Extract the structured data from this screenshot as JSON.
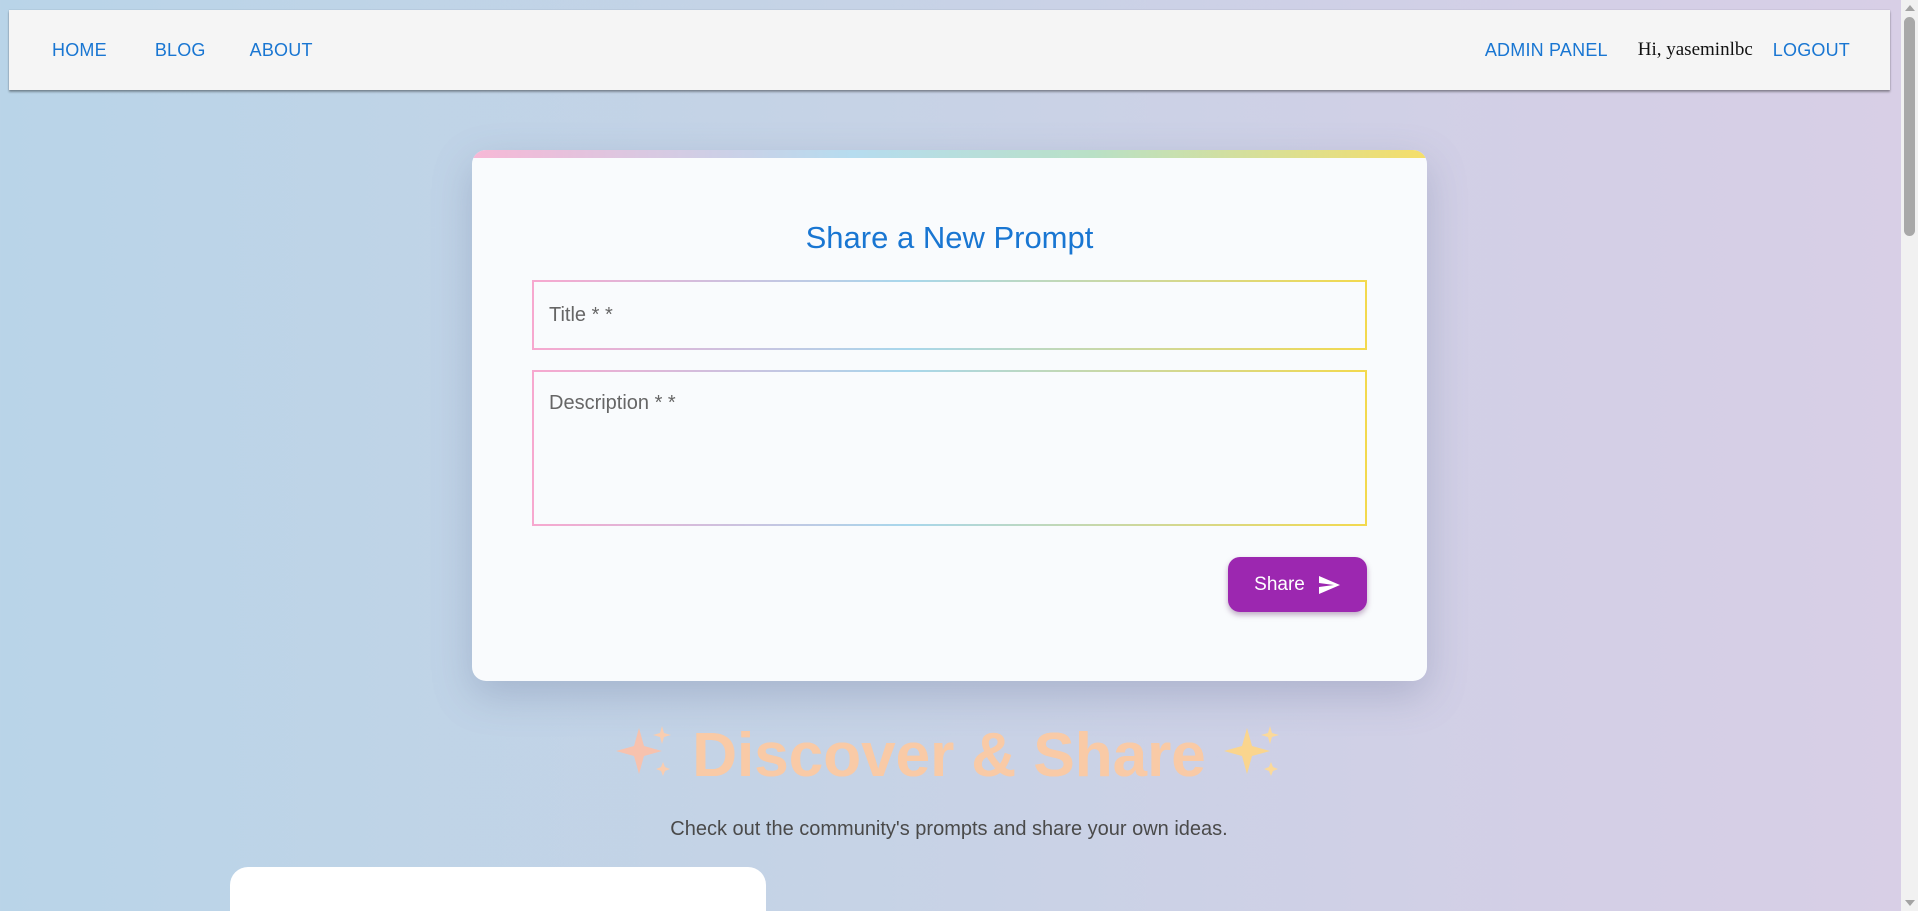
{
  "nav": {
    "home": "HOME",
    "blog": "BLOG",
    "about": "ABOUT",
    "admin": "ADMIN PANEL",
    "greeting": "Hi, yaseminlbc",
    "logout": "LOGOUT"
  },
  "form": {
    "title": "Share a New Prompt",
    "title_placeholder": "Title * *",
    "title_value": "",
    "description_placeholder": "Description * *",
    "description_value": "",
    "share_label": "Share",
    "share_icon": "send-icon"
  },
  "discover": {
    "heading": "Discover & Share",
    "subtitle": "Check out the community's prompts and share your own ideas.",
    "sparkle_icon": "sparkles-icon"
  },
  "colors": {
    "accent": "#1976d2",
    "button": "#9c27b0",
    "heading_gradient": [
      "#f7b9b0",
      "#fad48a"
    ]
  }
}
